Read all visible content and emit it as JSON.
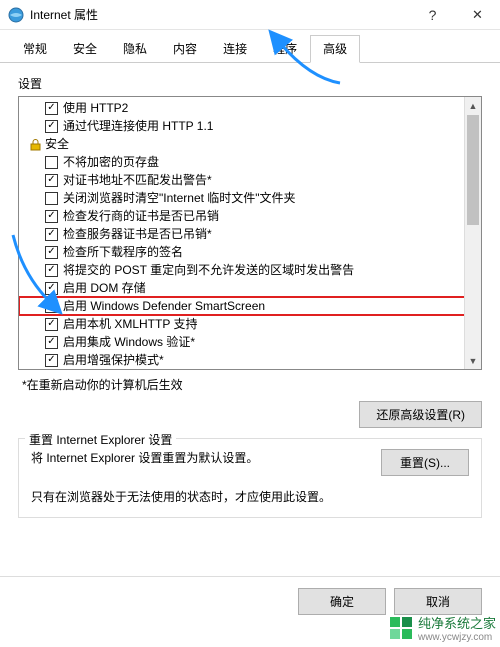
{
  "window": {
    "title": "Internet 属性",
    "help": "?",
    "close": "✕"
  },
  "tabs": [
    {
      "label": "常规"
    },
    {
      "label": "安全"
    },
    {
      "label": "隐私"
    },
    {
      "label": "内容"
    },
    {
      "label": "连接"
    },
    {
      "label": "程序"
    },
    {
      "label": "高级",
      "active": true
    }
  ],
  "settings_label": "设置",
  "list": [
    {
      "type": "item",
      "checked": true,
      "label": "使用 HTTP2"
    },
    {
      "type": "item",
      "checked": true,
      "label": "通过代理连接使用 HTTP 1.1"
    },
    {
      "type": "category",
      "icon": "lock",
      "label": "安全"
    },
    {
      "type": "item",
      "checked": false,
      "label": "不将加密的页存盘"
    },
    {
      "type": "item",
      "checked": true,
      "label": "对证书地址不匹配发出警告*"
    },
    {
      "type": "item",
      "checked": false,
      "label": "关闭浏览器时清空\"Internet 临时文件\"文件夹"
    },
    {
      "type": "item",
      "checked": true,
      "label": "检查发行商的证书是否已吊销"
    },
    {
      "type": "item",
      "checked": true,
      "label": "检查服务器证书是否已吊销*"
    },
    {
      "type": "item",
      "checked": true,
      "label": "检查所下载程序的签名"
    },
    {
      "type": "item",
      "checked": true,
      "label": "将提交的 POST 重定向到不允许发送的区域时发出警告"
    },
    {
      "type": "item",
      "checked": true,
      "label": "启用 DOM 存储"
    },
    {
      "type": "item",
      "checked": true,
      "label": "启用 Windows Defender SmartScreen",
      "highlight": true
    },
    {
      "type": "item",
      "checked": true,
      "label": "启用本机 XMLHTTP 支持"
    },
    {
      "type": "item",
      "checked": true,
      "label": "启用集成 Windows 验证*"
    },
    {
      "type": "item",
      "checked": true,
      "label": "启用增强保护模式*"
    }
  ],
  "restart_note": "*在重新启动你的计算机后生效",
  "restore_btn": "还原高级设置(R)",
  "reset": {
    "fieldset_label": "重置 Internet Explorer 设置",
    "text": "将 Internet Explorer 设置重置为默认设置。",
    "btn": "重置(S)...",
    "note": "只有在浏览器处于无法使用的状态时，才应使用此设置。"
  },
  "dialog": {
    "ok": "确定",
    "cancel": "取消"
  },
  "watermark": {
    "name": "纯净系统之家",
    "url": "www.ycwjzy.com"
  }
}
